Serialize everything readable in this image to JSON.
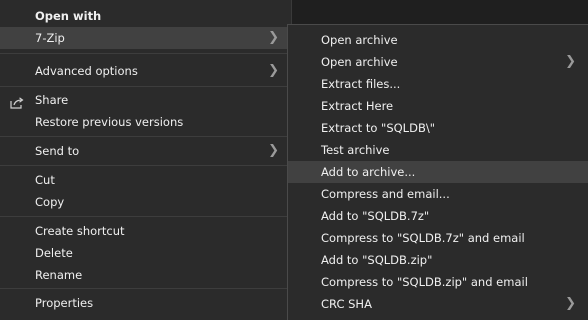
{
  "main_menu": {
    "heading": "Open with",
    "items": [
      {
        "label": "7-Zip",
        "has_submenu": true
      },
      {
        "label": "Advanced options",
        "has_submenu": true
      },
      {
        "label": "Share"
      },
      {
        "label": "Restore previous versions"
      },
      {
        "label": "Send to",
        "has_submenu": true
      },
      {
        "label": "Cut"
      },
      {
        "label": "Copy"
      },
      {
        "label": "Create shortcut"
      },
      {
        "label": "Delete"
      },
      {
        "label": "Rename"
      },
      {
        "label": "Properties"
      }
    ]
  },
  "sub_menu": {
    "items": [
      {
        "label": "Open archive"
      },
      {
        "label": "Open archive",
        "has_submenu": true
      },
      {
        "label": "Extract files..."
      },
      {
        "label": "Extract Here"
      },
      {
        "label": "Extract to \"SQLDB\\\""
      },
      {
        "label": "Test archive"
      },
      {
        "label": "Add to archive..."
      },
      {
        "label": "Compress and email..."
      },
      {
        "label": "Add to \"SQLDB.7z\""
      },
      {
        "label": "Compress to \"SQLDB.7z\" and email"
      },
      {
        "label": "Add to \"SQLDB.zip\""
      },
      {
        "label": "Compress to \"SQLDB.zip\" and email"
      },
      {
        "label": "CRC SHA",
        "has_submenu": true
      }
    ]
  },
  "icons": {
    "share": "share-icon",
    "submenu_arrow": "chevron-right-icon"
  },
  "colors": {
    "menu_bg": "#2b2b2b",
    "highlight": "#414141",
    "text": "#f0f0f0"
  }
}
